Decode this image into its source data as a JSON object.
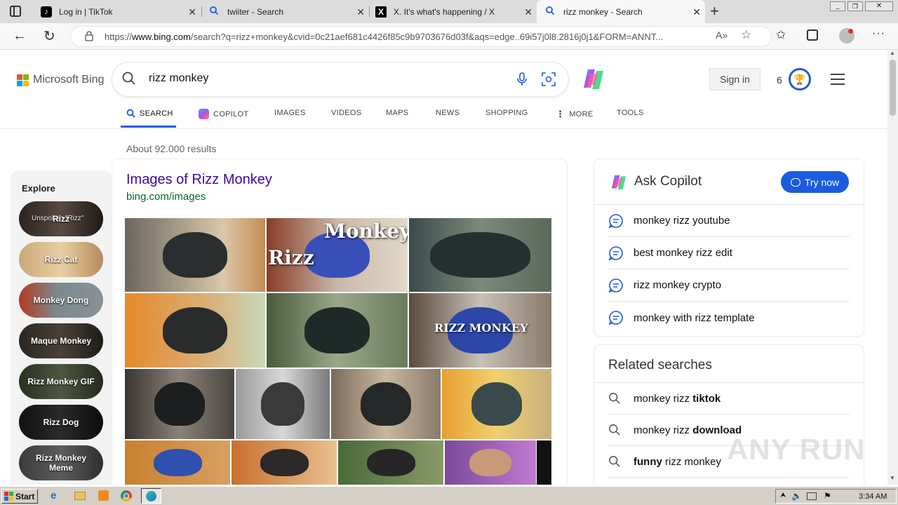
{
  "browser": {
    "tabs": [
      {
        "title": "Log in | TikTok",
        "icon": "tiktok-icon"
      },
      {
        "title": "twiiter - Search",
        "icon": "search-icon"
      },
      {
        "title": "X. It's what's happening / X",
        "icon": "x-icon"
      },
      {
        "title": "rizz monkey - Search",
        "icon": "search-icon",
        "active": true
      }
    ],
    "url_prefix": "https://",
    "url_host": "www.bing.com",
    "url_rest": "/search?q=rizz+monkey&cvid=0c21aef681c4426f85c9b9703676d03f&aqs=edge..69i57j0l8.2816j0j1&FORM=ANNT..."
  },
  "bing": {
    "logo_text": "Microsoft Bing",
    "query": "rizz monkey",
    "sign_in_label": "Sign in",
    "rewards_count": "6",
    "nav_tabs": [
      {
        "label": "SEARCH",
        "active": true
      },
      {
        "label": "COPILOT"
      },
      {
        "label": "IMAGES"
      },
      {
        "label": "VIDEOS"
      },
      {
        "label": "MAPS"
      },
      {
        "label": "NEWS"
      },
      {
        "label": "SHOPPING"
      },
      {
        "label": "MORE"
      },
      {
        "label": "TOOLS"
      }
    ],
    "results_count": "About 92.000 results",
    "explore": {
      "heading": "Explore",
      "items": [
        "Rizz",
        "Rizz Cat",
        "Monkey Dong",
        "Maque Monkey",
        "Rizz Monkey GIF",
        "Rizz Dog",
        "Rizz Monkey Meme"
      ],
      "first_item_overlay": "Unspoken \"Rizz\""
    },
    "images_result": {
      "title": "Images of Rizz Monkey",
      "source": "bing.com/images",
      "overlay_1": "Rizz",
      "overlay_1b": "Monkey",
      "overlay_2": "RIZZ MONKEY"
    },
    "copilot_card": {
      "title": "Ask Copilot",
      "try_now_label": "Try now",
      "suggestions": [
        "monkey rizz youtube",
        "best monkey rizz edit",
        "rizz monkey crypto",
        "monkey with rizz template"
      ]
    },
    "related": {
      "title": "Related searches",
      "items": [
        {
          "plain": "monkey rizz ",
          "bold": "tiktok"
        },
        {
          "plain": "monkey rizz ",
          "bold": "download"
        },
        {
          "plain": "",
          "bold": "funny",
          "plain_after": " rizz monkey"
        }
      ]
    },
    "watermark": "ANY RUN"
  },
  "taskbar": {
    "start_label": "Start",
    "clock": "3:34 AM"
  },
  "colors": {
    "accent_blue": "#1a5cde",
    "link_purple": "#4007a2",
    "source_green": "#006d21"
  }
}
